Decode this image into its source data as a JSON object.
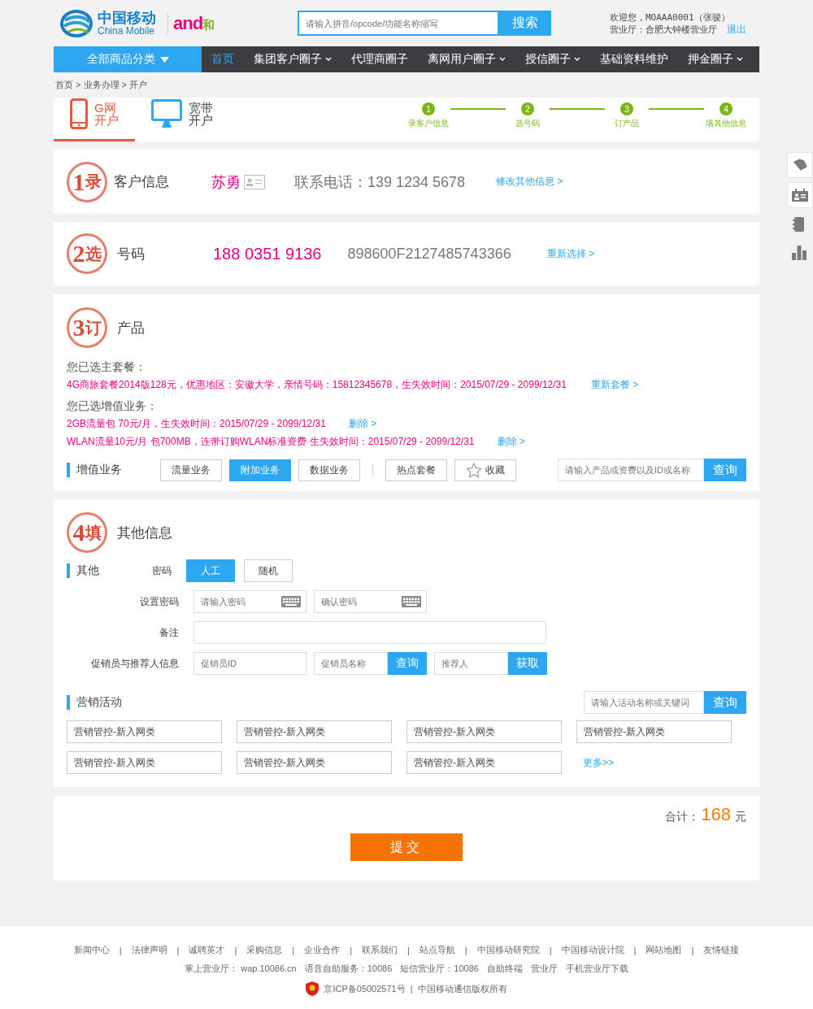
{
  "header": {
    "logo": {
      "name_cn": "中国移动",
      "name_en": "China Mobile",
      "sub_brand_a": "and",
      "sub_brand_b": "和"
    },
    "search": {
      "placeholder": "请输入拼音/opcode/功能名称缩写",
      "button": "搜索"
    },
    "user": {
      "welcome": "欢迎您，MOAAA0001（张骏）",
      "hall": "营业厅：合肥大钟楼营业厅",
      "logout": "退出"
    }
  },
  "nav": {
    "category": "全部商品分类",
    "items": [
      {
        "label": "首页",
        "selected": true,
        "dropdown": false
      },
      {
        "label": "集团客户圈子",
        "selected": false,
        "dropdown": true
      },
      {
        "label": "代理商圈子",
        "selected": false,
        "dropdown": false
      },
      {
        "label": "离网用户圈子",
        "selected": false,
        "dropdown": true
      },
      {
        "label": "授信圈子",
        "selected": false,
        "dropdown": true
      },
      {
        "label": "基础资料维护",
        "selected": false,
        "dropdown": false
      },
      {
        "label": "押金圈子",
        "selected": false,
        "dropdown": true
      }
    ]
  },
  "breadcrumb": "首页 > 业务办理 > 开户",
  "open_tabs": [
    {
      "kind": "phone",
      "line_1": "G网",
      "line_2": "开户",
      "selected": true
    },
    {
      "kind": "monitor",
      "line_1": "宽带",
      "line_2": "开户",
      "selected": false
    }
  ],
  "steps": [
    {
      "number": "1",
      "label": "录客户信息"
    },
    {
      "number": "2",
      "label": "选号码"
    },
    {
      "number": "3",
      "label": "订产品"
    },
    {
      "number": "4",
      "label": "填其他信息"
    }
  ],
  "customer": {
    "stamp": {
      "number": "1",
      "char": "录"
    },
    "title": "客户信息",
    "name": "苏勇",
    "phone": "联系电话：139 1234 5678",
    "link": "修改其他信息 >"
  },
  "number": {
    "stamp": {
      "number": "2",
      "char": "选"
    },
    "title": "号码",
    "msisdn": "188 0351 9136",
    "iccid": "898600F2127485743366",
    "link": "重新选择 >"
  },
  "product": {
    "stamp": {
      "number": "3",
      "char": "订"
    },
    "title": "产品",
    "main_label": "您已选主套餐：",
    "main_plan": {
      "text": "4G商旅套餐2014版128元，优惠地区：安徽大学，亲情号码：15812345678，生失效时间：2015/07/29 - 2099/12/31",
      "link": "重新套餐 >"
    },
    "vas_label": "您已选增值业务：",
    "vas": [
      {
        "text": "2GB流量包 70元/月，生失效时间：2015/07/29 - 2099/12/31",
        "link": "删除 >"
      },
      {
        "text": "WLAN流量10元/月 包700MB，连带订购WLAN标准资费  生失效时间：2015/07/29 - 2099/12/31",
        "link": "删除 >"
      }
    ],
    "toolbar": {
      "title": "增值业务",
      "tabs": [
        {
          "label": "流量业务",
          "selected": false,
          "kind": "tab"
        },
        {
          "label": "附加业务",
          "selected": true,
          "kind": "tab"
        },
        {
          "label": "数据业务",
          "selected": false,
          "kind": "tab"
        },
        {
          "label": "热点套餐",
          "selected": false,
          "kind": "tab"
        },
        {
          "label": "收藏",
          "selected": false,
          "kind": "favorite"
        }
      ],
      "search": {
        "placeholder": "请输入产品或资费以及ID或名称",
        "button": "查询"
      }
    }
  },
  "other": {
    "stamp": {
      "number": "4",
      "char": "填"
    },
    "title": "其他信息",
    "group_title": "其他",
    "password": {
      "label": "密码",
      "options": [
        {
          "label": "人工",
          "selected": true
        },
        {
          "label": "随机",
          "selected": false
        }
      ]
    },
    "set_password": {
      "label": "设置密码",
      "fields": [
        {
          "placeholder": "请输入密码"
        },
        {
          "placeholder": "确认密码"
        }
      ]
    },
    "remark": {
      "label": "备注"
    },
    "promoter": {
      "label": "促销员与推荐人信息",
      "id_placeholder": "促销员ID",
      "fields": [
        {
          "placeholder": "促销员名称",
          "button": "查询"
        },
        {
          "placeholder": "推荐人",
          "button": "获取"
        }
      ]
    },
    "marketing": {
      "title": "营销活动",
      "search": {
        "placeholder": "请输入活动名称或关键词",
        "button": "查询"
      },
      "items": [
        "营销管控-新入网类",
        "营销管控-新入网类",
        "营销管控-新入网类",
        "营销管控-新入网类",
        "营销管控-新入网类",
        "营销管控-新入网类",
        "营销管控-新入网类"
      ],
      "more": "更多>>"
    }
  },
  "total": {
    "label": "合计：",
    "amount": "168",
    "unit": "元"
  },
  "submit": "提交",
  "footer": {
    "links": [
      "新闻中心",
      "法律声明",
      "诚聘英才",
      "采购信息",
      "企业合作",
      "联系我们",
      "站点导航",
      "中国移动研究院",
      "中国移动设计院",
      "网站地图",
      "友情链接"
    ],
    "separator": "|",
    "services": [
      "掌上营业厅： wap.10086.cn",
      "语音自助服务：10086",
      "短信营业厅：10086",
      "自助终端",
      "营业厅",
      "手机营业厅下载"
    ],
    "icp": "京ICP备05002571号",
    "icp_separator": "|",
    "copyright": "中国移动通信版权所有"
  }
}
